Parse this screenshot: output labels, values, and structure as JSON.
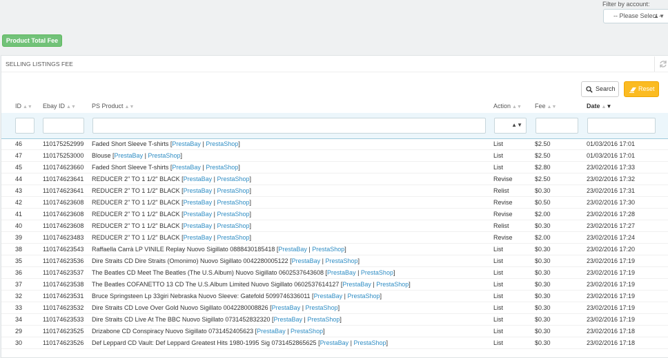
{
  "filter": {
    "label": "Filter by account:",
    "select_value": "-- Please Select --"
  },
  "product_total_fee_label": "Product Total Fee",
  "panel": {
    "title": "SELLING LISTINGS FEE"
  },
  "buttons": {
    "search": "Search",
    "reset": "Reset"
  },
  "columns": {
    "id": "ID",
    "ebay_id": "Ebay ID",
    "ps_product": "PS Product",
    "action": "Action",
    "fee": "Fee",
    "date": "Date"
  },
  "links": {
    "prestabay": "PrestaBay",
    "prestashop": "PrestaShop"
  },
  "rows": [
    {
      "id": "46",
      "ebay_id": "110175252999",
      "product": "Faded Short Sleeve T-shirts",
      "action": "List",
      "fee": "$2.50",
      "date": "01/03/2016 17:01"
    },
    {
      "id": "47",
      "ebay_id": "110175253000",
      "product": "Blouse",
      "action": "List",
      "fee": "$2.50",
      "date": "01/03/2016 17:01"
    },
    {
      "id": "45",
      "ebay_id": "110174623660",
      "product": "Faded Short Sleeve T-shirts",
      "action": "List",
      "fee": "$2.80",
      "date": "23/02/2016 17:33"
    },
    {
      "id": "44",
      "ebay_id": "110174623641",
      "product": "REDUCER 2\" TO 1 1/2\" BLACK",
      "action": "Revise",
      "fee": "$2.50",
      "date": "23/02/2016 17:32"
    },
    {
      "id": "43",
      "ebay_id": "110174623641",
      "product": "REDUCER 2\" TO 1 1/2\" BLACK",
      "action": "Relist",
      "fee": "$0.30",
      "date": "23/02/2016 17:31"
    },
    {
      "id": "42",
      "ebay_id": "110174623608",
      "product": "REDUCER 2\" TO 1 1/2\" BLACK",
      "action": "Revise",
      "fee": "$0.50",
      "date": "23/02/2016 17:30"
    },
    {
      "id": "41",
      "ebay_id": "110174623608",
      "product": "REDUCER 2\" TO 1 1/2\" BLACK",
      "action": "Revise",
      "fee": "$2.00",
      "date": "23/02/2016 17:28"
    },
    {
      "id": "40",
      "ebay_id": "110174623608",
      "product": "REDUCER 2\" TO 1 1/2\" BLACK",
      "action": "Relist",
      "fee": "$0.30",
      "date": "23/02/2016 17:27"
    },
    {
      "id": "39",
      "ebay_id": "110174623483",
      "product": "REDUCER 2\" TO 1 1/2\" BLACK",
      "action": "Revise",
      "fee": "$2.00",
      "date": "23/02/2016 17:24"
    },
    {
      "id": "38",
      "ebay_id": "110174623543",
      "product": "Raffaella Carrà LP VINILE Replay Nuovo Sigillato 0888430185418",
      "action": "List",
      "fee": "$0.30",
      "date": "23/02/2016 17:20"
    },
    {
      "id": "35",
      "ebay_id": "110174623536",
      "product": "Dire Straits CD Dire Straits (Omonimo) Nuovo Sigillato 0042280005122",
      "action": "List",
      "fee": "$0.30",
      "date": "23/02/2016 17:19"
    },
    {
      "id": "36",
      "ebay_id": "110174623537",
      "product": "The Beatles CD Meet The Beatles (The U.S.Album) Nuovo Sigillato 0602537643608",
      "action": "List",
      "fee": "$0.30",
      "date": "23/02/2016 17:19"
    },
    {
      "id": "37",
      "ebay_id": "110174623538",
      "product": "The Beatles COFANETTO 13 CD The U.S.Album Limited Nuovo Sigillato 0602537614127",
      "action": "List",
      "fee": "$0.30",
      "date": "23/02/2016 17:19"
    },
    {
      "id": "32",
      "ebay_id": "110174623531",
      "product": "Bruce Springsteen Lp 33giri Nebraska Nuovo Sleeve: Gatefold 5099746336011",
      "action": "List",
      "fee": "$0.30",
      "date": "23/02/2016 17:19"
    },
    {
      "id": "33",
      "ebay_id": "110174623532",
      "product": "Dire Straits CD Love Over Gold Nuovo Sigillato 0042280008826",
      "action": "List",
      "fee": "$0.30",
      "date": "23/02/2016 17:19"
    },
    {
      "id": "34",
      "ebay_id": "110174623533",
      "product": "Dire Straits CD Live At The BBC Nuovo Sigillato 0731452832320",
      "action": "List",
      "fee": "$0.30",
      "date": "23/02/2016 17:19"
    },
    {
      "id": "29",
      "ebay_id": "110174623525",
      "product": "Drizabone CD Conspiracy Nuovo Sigillato 0731452405623",
      "action": "List",
      "fee": "$0.30",
      "date": "23/02/2016 17:18"
    },
    {
      "id": "30",
      "ebay_id": "110174623526",
      "product": "Def Leppard CD Vault: Def Leppard Greatest Hits 1980-1995 Sig 0731452865625",
      "action": "List",
      "fee": "$0.30",
      "date": "23/02/2016 17:18"
    }
  ]
}
